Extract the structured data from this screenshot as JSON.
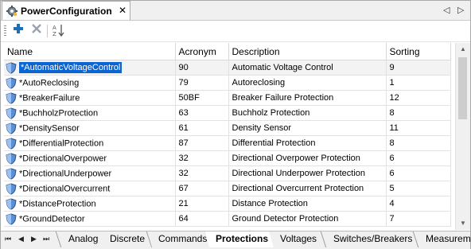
{
  "window": {
    "tab_title": "PowerConfiguration",
    "tab_icon": "gear-icon",
    "close_glyph": "✕",
    "scroll_left_glyph": "◁",
    "scroll_right_glyph": "▷"
  },
  "toolbar": {
    "add_icon": "plus-icon",
    "delete_icon": "delete-x-icon",
    "sort_icon": "sort-az-icon",
    "add_color": "#1f6fb5",
    "delete_color": "#9aa3ad"
  },
  "grid": {
    "columns": [
      "Name",
      "Acronym",
      "Description",
      "Sorting"
    ],
    "row_icon": "shield-icon",
    "rows": [
      {
        "name": "*AutomaticVoltageControl",
        "acronym": "90",
        "description": "Automatic Voltage Control",
        "sorting": "9"
      },
      {
        "name": "*AutoReclosing",
        "acronym": "79",
        "description": "Autoreclosing",
        "sorting": "1"
      },
      {
        "name": "*BreakerFailure",
        "acronym": "50BF",
        "description": "Breaker Failure Protection",
        "sorting": "12"
      },
      {
        "name": "*BuchholzProtection",
        "acronym": "63",
        "description": "Buchholz Protection",
        "sorting": "8"
      },
      {
        "name": "*DensitySensor",
        "acronym": "61",
        "description": "Density Sensor",
        "sorting": "11"
      },
      {
        "name": "*DifferentialProtection",
        "acronym": "87",
        "description": "Differential Protection",
        "sorting": "8"
      },
      {
        "name": "*DirectionalOverpower",
        "acronym": "32",
        "description": "Directional Overpower Protection",
        "sorting": "6"
      },
      {
        "name": "*DirectionalUnderpower",
        "acronym": "32",
        "description": "Directional Underpower Protection",
        "sorting": "6"
      },
      {
        "name": "*DirectionalOvercurrent",
        "acronym": "67",
        "description": "Directional Overcurrent Protection",
        "sorting": "5"
      },
      {
        "name": "*DistanceProtection",
        "acronym": "21",
        "description": "Distance Protection",
        "sorting": "4"
      },
      {
        "name": "*GroundDetector",
        "acronym": "64",
        "description": "Ground Detector Protection",
        "sorting": "7"
      }
    ],
    "selected_color": "#0a64d2"
  },
  "sheet_tabs": {
    "nav_glyphs": [
      "⏮",
      "◀",
      "▶",
      "⏭"
    ],
    "tabs": [
      "Analog",
      "Discrete",
      "Commands",
      "Protections",
      "Voltages",
      "Switches/Breakers",
      "Measurement"
    ],
    "active": "Protections"
  }
}
